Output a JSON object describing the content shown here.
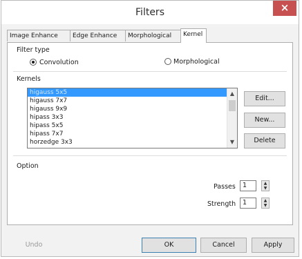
{
  "window": {
    "title": "Filters",
    "close_symbol": "×"
  },
  "tabs": [
    {
      "label": "Image Enhance",
      "active": false
    },
    {
      "label": "Edge Enhance",
      "active": false
    },
    {
      "label": "Morphological",
      "active": false
    },
    {
      "label": "Kernel",
      "active": true
    }
  ],
  "filter_type": {
    "label": "Filter type",
    "options": [
      {
        "label": "Convolution",
        "selected": true
      },
      {
        "label": "Morphological",
        "selected": false
      }
    ]
  },
  "kernels": {
    "label": "Kernels",
    "items": [
      "higauss 5x5",
      "higauss 7x7",
      "higauss 9x9",
      "hipass 3x3",
      "hipass 5x5",
      "hipass 7x7",
      "horzedge 3x3"
    ],
    "selected": "higauss 5x5",
    "buttons": {
      "edit": "Edit...",
      "new": "New...",
      "delete": "Delete"
    }
  },
  "option": {
    "label": "Option",
    "passes_label": "Passes",
    "passes_value": "1",
    "strength_label": "Strength",
    "strength_value": "1"
  },
  "footer": {
    "undo": "Undo",
    "ok": "OK",
    "cancel": "Cancel",
    "apply": "Apply"
  }
}
